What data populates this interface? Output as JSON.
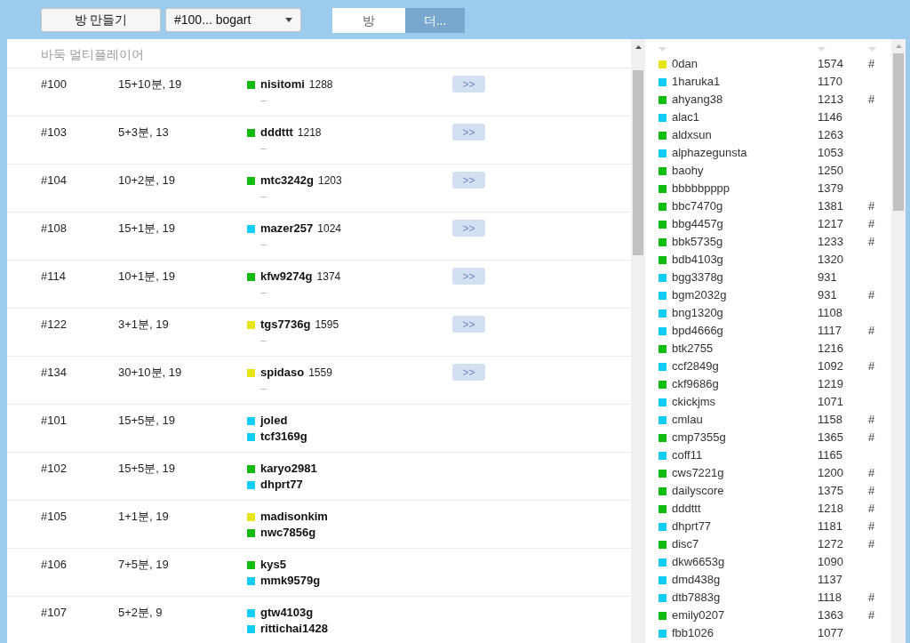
{
  "toolbar": {
    "create_button": "방 만들기",
    "room_select": {
      "value": "#100... bogart"
    }
  },
  "tabs": [
    {
      "label": "방",
      "selected": true
    },
    {
      "label": "더...",
      "selected": false
    }
  ],
  "rooms_panel": {
    "title": "바둑 멀티플레이어",
    "rooms": [
      {
        "number": "#100",
        "time": "15+10분, 19",
        "players": [
          {
            "kind": "player",
            "name": "nisitomi",
            "rating": "1288",
            "color": "#11bb11"
          },
          {
            "kind": "empty",
            "label": "–"
          }
        ],
        "join_button": ">>"
      },
      {
        "number": "#103",
        "time": "5+3분, 13",
        "players": [
          {
            "kind": "player",
            "name": "dddttt",
            "rating": "1218",
            "color": "#11bb11"
          },
          {
            "kind": "empty",
            "label": "–"
          }
        ],
        "join_button": ">>"
      },
      {
        "number": "#104",
        "time": "10+2분, 19",
        "players": [
          {
            "kind": "player",
            "name": "mtc3242g",
            "rating": "1203",
            "color": "#11bb11"
          },
          {
            "kind": "empty",
            "label": "–"
          }
        ],
        "join_button": ">>"
      },
      {
        "number": "#108",
        "time": "15+1분, 19",
        "players": [
          {
            "kind": "player",
            "name": "mazer257",
            "rating": "1024",
            "color": "#11ccf5"
          },
          {
            "kind": "empty",
            "label": "–"
          }
        ],
        "join_button": ">>"
      },
      {
        "number": "#114",
        "time": "10+1분, 19",
        "players": [
          {
            "kind": "player",
            "name": "kfw9274g",
            "rating": "1374",
            "color": "#11bb11"
          },
          {
            "kind": "empty",
            "label": "–"
          }
        ],
        "join_button": ">>"
      },
      {
        "number": "#122",
        "time": "3+1분, 19",
        "players": [
          {
            "kind": "player",
            "name": "tgs7736g",
            "rating": "1595",
            "color": "#e5e51a"
          },
          {
            "kind": "empty",
            "label": "–"
          }
        ],
        "join_button": ">>"
      },
      {
        "number": "#134",
        "time": "30+10분, 19",
        "players": [
          {
            "kind": "player",
            "name": "spidaso",
            "rating": "1559",
            "color": "#e5e51a"
          },
          {
            "kind": "empty",
            "label": "–"
          }
        ],
        "join_button": ">>"
      },
      {
        "number": "#101",
        "time": "15+5분, 19",
        "players": [
          {
            "kind": "player",
            "name": "joled",
            "color": "#11ccf5"
          },
          {
            "kind": "player",
            "name": "tcf3169g",
            "color": "#11ccf5"
          }
        ]
      },
      {
        "number": "#102",
        "time": "15+5분, 19",
        "players": [
          {
            "kind": "player",
            "name": "karyo2981",
            "color": "#11bb11"
          },
          {
            "kind": "player",
            "name": "dhprt77",
            "color": "#11ccf5"
          }
        ]
      },
      {
        "number": "#105",
        "time": "1+1분, 19",
        "players": [
          {
            "kind": "player",
            "name": "madisonkim",
            "color": "#e5e51a"
          },
          {
            "kind": "player",
            "name": "nwc7856g",
            "color": "#11bb11"
          }
        ]
      },
      {
        "number": "#106",
        "time": "7+5분, 19",
        "players": [
          {
            "kind": "player",
            "name": "kys5",
            "color": "#11bb11"
          },
          {
            "kind": "player",
            "name": "mmk9579g",
            "color": "#11ccf5"
          }
        ]
      },
      {
        "number": "#107",
        "time": "5+2분, 9",
        "players": [
          {
            "kind": "player",
            "name": "gtw4103g",
            "color": "#11ccf5"
          },
          {
            "kind": "player",
            "name": "rittichai1428",
            "color": "#11ccf5"
          }
        ]
      }
    ]
  },
  "users_panel": {
    "users": [
      {
        "name": "0dan",
        "rating": "1574",
        "mark": "#",
        "color": "#e5e51a"
      },
      {
        "name": "1haruka1",
        "rating": "1170",
        "color": "#11ccf5"
      },
      {
        "name": "ahyang38",
        "rating": "1213",
        "mark": "#",
        "color": "#11bb11"
      },
      {
        "name": "alac1",
        "rating": "1146",
        "color": "#11ccf5"
      },
      {
        "name": "aldxsun",
        "rating": "1263",
        "color": "#11bb11"
      },
      {
        "name": "alphazegunsta",
        "rating": "1053",
        "color": "#11ccf5"
      },
      {
        "name": "baohy",
        "rating": "1250",
        "color": "#11bb11"
      },
      {
        "name": "bbbbbpppp",
        "rating": "1379",
        "color": "#11bb11"
      },
      {
        "name": "bbc7470g",
        "rating": "1381",
        "mark": "#",
        "color": "#11bb11"
      },
      {
        "name": "bbg4457g",
        "rating": "1217",
        "mark": "#",
        "color": "#11bb11"
      },
      {
        "name": "bbk5735g",
        "rating": "1233",
        "mark": "#",
        "color": "#11bb11"
      },
      {
        "name": "bdb4103g",
        "rating": "1320",
        "color": "#11bb11"
      },
      {
        "name": "bgg3378g",
        "rating": "931",
        "color": "#11ccf5"
      },
      {
        "name": "bgm2032g",
        "rating": "931",
        "mark": "#",
        "color": "#11ccf5"
      },
      {
        "name": "bng1320g",
        "rating": "1108",
        "color": "#11ccf5"
      },
      {
        "name": "bpd4666g",
        "rating": "1117",
        "mark": "#",
        "color": "#11ccf5"
      },
      {
        "name": "btk2755",
        "rating": "1216",
        "color": "#11bb11"
      },
      {
        "name": "ccf2849g",
        "rating": "1092",
        "mark": "#",
        "color": "#11ccf5"
      },
      {
        "name": "ckf9686g",
        "rating": "1219",
        "color": "#11bb11"
      },
      {
        "name": "ckickjms",
        "rating": "1071",
        "color": "#11ccf5"
      },
      {
        "name": "cmlau",
        "rating": "1158",
        "mark": "#",
        "color": "#11ccf5"
      },
      {
        "name": "cmp7355g",
        "rating": "1365",
        "mark": "#",
        "color": "#11bb11"
      },
      {
        "name": "coff11",
        "rating": "1165",
        "color": "#11ccf5"
      },
      {
        "name": "cws7221g",
        "rating": "1200",
        "mark": "#",
        "color": "#11bb11"
      },
      {
        "name": "dailyscore",
        "rating": "1375",
        "mark": "#",
        "color": "#11bb11"
      },
      {
        "name": "dddttt",
        "rating": "1218",
        "mark": "#",
        "color": "#11bb11"
      },
      {
        "name": "dhprt77",
        "rating": "1181",
        "mark": "#",
        "color": "#11ccf5"
      },
      {
        "name": "disc7",
        "rating": "1272",
        "mark": "#",
        "color": "#11bb11"
      },
      {
        "name": "dkw6653g",
        "rating": "1090",
        "color": "#11ccf5"
      },
      {
        "name": "dmd438g",
        "rating": "1137",
        "color": "#11ccf5"
      },
      {
        "name": "dtb7883g",
        "rating": "1118",
        "mark": "#",
        "color": "#11ccf5"
      },
      {
        "name": "emily0207",
        "rating": "1363",
        "mark": "#",
        "color": "#11bb11"
      },
      {
        "name": "fbb1026",
        "rating": "1077",
        "color": "#11ccf5"
      }
    ]
  }
}
